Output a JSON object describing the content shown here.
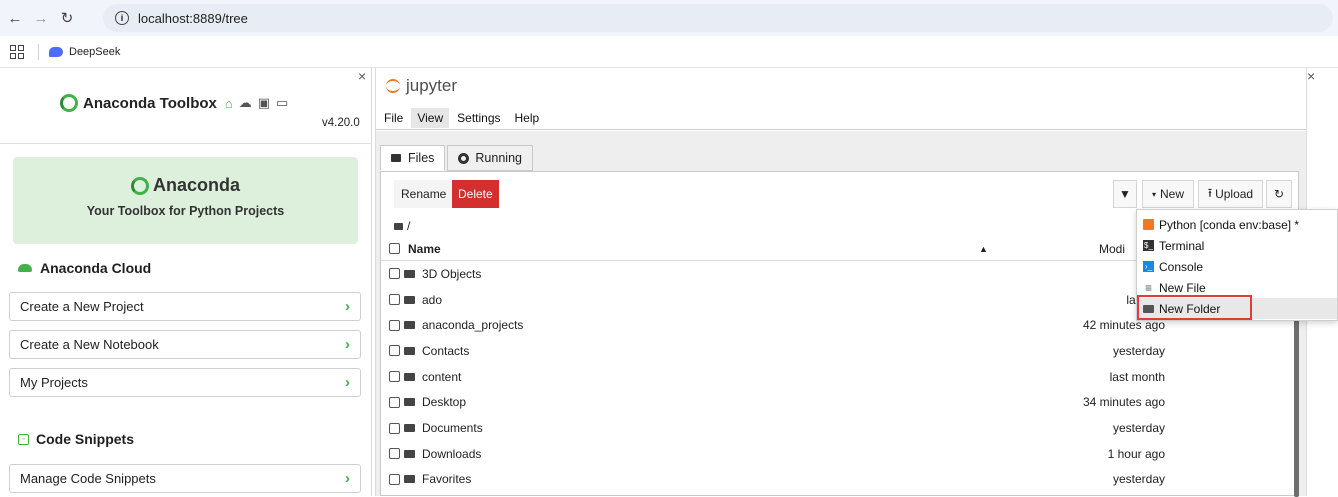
{
  "browser": {
    "url": "localhost:8889/tree",
    "bookmark": "DeepSeek",
    "icons": [
      "back-arrow-icon",
      "forward-arrow-icon",
      "reload-icon",
      "site-info-icon",
      "apps-grid-icon"
    ]
  },
  "toolbox": {
    "title": "Anaconda Toolbox",
    "version": "v4.20.0",
    "banner_title": "Anaconda",
    "banner_subtitle": "Your Toolbox for Python Projects",
    "cloud_section": "Anaconda Cloud",
    "actions": [
      "Create a New Project",
      "Create a New Notebook",
      "My Projects"
    ],
    "snippets_section": "Code Snippets",
    "snippets_action": "Manage Code Snippets",
    "chevron": "›",
    "close": "×",
    "accent": "#43b049"
  },
  "jupyter": {
    "logo": "jupyter",
    "close": "×",
    "menu": [
      "File",
      "View",
      "Settings",
      "Help"
    ],
    "tabs": [
      "Files",
      "Running"
    ],
    "toolbar": {
      "rename": "Rename",
      "delete": "Delete",
      "new": "New",
      "upload": "Upload"
    },
    "breadcrumb": "/",
    "columns": {
      "name": "Name",
      "modified": "Modi"
    },
    "files": [
      {
        "name": "3D Objects",
        "modified": "yeste"
      },
      {
        "name": "ado",
        "modified": "last mo"
      },
      {
        "name": "anaconda_projects",
        "modified": "42 minutes ago"
      },
      {
        "name": "Contacts",
        "modified": "yesterday"
      },
      {
        "name": "content",
        "modified": "last month"
      },
      {
        "name": "Desktop",
        "modified": "34 minutes ago"
      },
      {
        "name": "Documents",
        "modified": "yesterday"
      },
      {
        "name": "Downloads",
        "modified": "1 hour ago"
      },
      {
        "name": "Favorites",
        "modified": "yesterday"
      }
    ],
    "new_menu": [
      "Python [conda env:base] *",
      "Terminal",
      "Console",
      "New File",
      "New Folder"
    ],
    "colors": {
      "delete": "#d32f2f",
      "highlight": "#e03c3c",
      "logo": "#f37726"
    }
  }
}
